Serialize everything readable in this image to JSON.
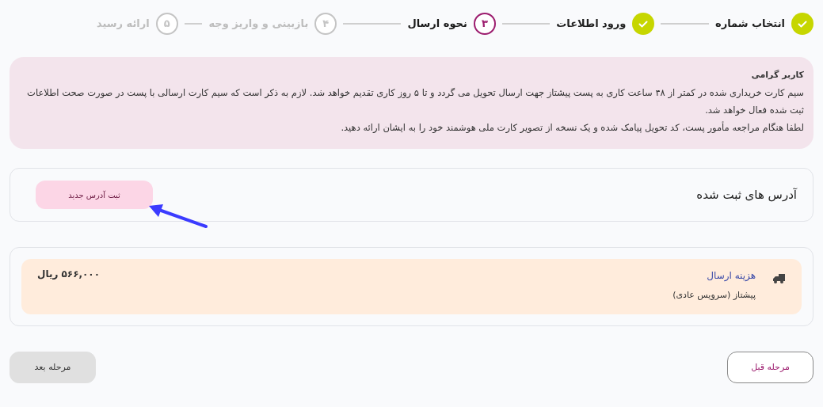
{
  "stepper": [
    {
      "label": "انتخاب شماره",
      "done": true,
      "selected": false
    },
    {
      "label": "ورود اطلاعات",
      "done": true,
      "selected": false
    },
    {
      "number": "۳",
      "label": "نحوه ارسال",
      "done": false,
      "selected": true
    },
    {
      "number": "۴",
      "label": "بازبینی و واریز وجه",
      "done": false,
      "selected": false
    },
    {
      "number": "۵",
      "label": "ارائه رسید",
      "done": false,
      "selected": false
    }
  ],
  "notice": {
    "title": "کاربر گرامی",
    "paragraphs": [
      "سیم کارت خریداری شده در کمتر از ۴۸ ساعت کاری به پست پیشتاز جهت ارسال تحویل می گردد و تا ۵ روز کاری تقدیم خواهد شد. لازم به ذکر است که سیم کارت ارسالی با پست در صورت صحت اطلاعات ثبت شده فعال خواهد شد.",
      "لطفا هنگام مراجعه مأمور پست، کد تحویل پیامک شده و یک نسخه از تصویر کارت ملی هوشمند خود را به ایشان ارائه دهید."
    ]
  },
  "addresses": {
    "title": "آدرس های ثبت شده",
    "new_button": "ثبت آدرس جدید"
  },
  "shipping": {
    "title": "هزینه ارسال",
    "method": "پیشتاز (سرویس عادی)",
    "price": "۵۶۶,۰۰۰ ریال"
  },
  "buttons": {
    "previous": {
      "label": "مرحله قبل",
      "disabled": false
    },
    "next": {
      "label": "مرحله بعد",
      "disabled": true
    }
  }
}
